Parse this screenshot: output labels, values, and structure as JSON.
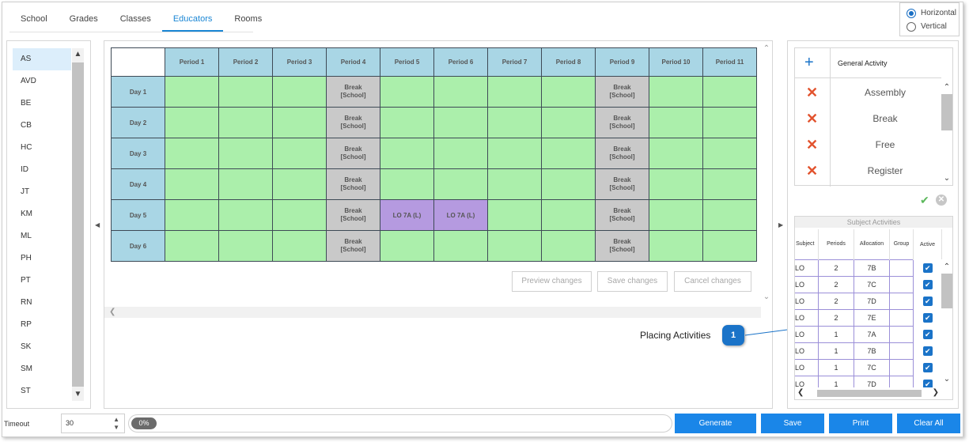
{
  "tabs": [
    "School",
    "Grades",
    "Classes",
    "Educators",
    "Rooms"
  ],
  "active_tab": "Educators",
  "orientation": {
    "options": [
      "Horizontal",
      "Vertical"
    ],
    "selected": "Horizontal"
  },
  "educators": [
    "AS",
    "AVD",
    "BE",
    "CB",
    "HC",
    "ID",
    "JT",
    "KM",
    "ML",
    "PH",
    "PT",
    "RN",
    "RP",
    "SK",
    "SM",
    "ST"
  ],
  "selected_educator": "AS",
  "timetable": {
    "periods": [
      "Period 1",
      "Period 2",
      "Period 3",
      "Period 4",
      "Period 5",
      "Period 6",
      "Period 7",
      "Period 8",
      "Period 9",
      "Period 10",
      "Period 11"
    ],
    "days": [
      "Day 1",
      "Day 2",
      "Day 3",
      "Day 4",
      "Day 5",
      "Day 6"
    ],
    "break_label": "Break",
    "break_scope": "[School]",
    "break_periods": [
      "Period 4",
      "Period 9"
    ],
    "activities": [
      {
        "day": "Day 5",
        "period": "Period 5",
        "label": "LO 7A (L)"
      },
      {
        "day": "Day 5",
        "period": "Period 6",
        "label": "LO 7A (L)"
      }
    ]
  },
  "change_buttons": {
    "preview": "Preview changes",
    "save": "Save changes",
    "cancel": "Cancel changes"
  },
  "callout": {
    "label": "Placing Activities",
    "number": "1"
  },
  "general_activity": {
    "title": "General Activity",
    "items": [
      "Assembly",
      "Break",
      "Free",
      "Register"
    ]
  },
  "subject_activities": {
    "title": "Subject Activities",
    "columns": [
      "Subject",
      "Periods",
      "Allocation",
      "Group",
      "Active"
    ],
    "rows": [
      {
        "subject": "LO",
        "periods": "2",
        "allocation": "7B",
        "group": ""
      },
      {
        "subject": "LO",
        "periods": "2",
        "allocation": "7C",
        "group": ""
      },
      {
        "subject": "LO",
        "periods": "2",
        "allocation": "7D",
        "group": ""
      },
      {
        "subject": "LO",
        "periods": "2",
        "allocation": "7E",
        "group": ""
      },
      {
        "subject": "LO",
        "periods": "1",
        "allocation": "7A",
        "group": ""
      },
      {
        "subject": "LO",
        "periods": "1",
        "allocation": "7B",
        "group": ""
      },
      {
        "subject": "LO",
        "periods": "1",
        "allocation": "7C",
        "group": ""
      },
      {
        "subject": "LO",
        "periods": "1",
        "allocation": "7D",
        "group": ""
      }
    ]
  },
  "bottom": {
    "timeout_label": "Timeout",
    "timeout_value": "30",
    "progress_text": "0%",
    "buttons": {
      "generate": "Generate",
      "save": "Save",
      "print": "Print",
      "clear": "Clear All"
    }
  },
  "colors": {
    "accent": "#1a86e8",
    "header_cell": "#a9d6e5",
    "empty_cell": "#abefab",
    "break_cell": "#c9c9c9",
    "activity_cell": "#b59ae0"
  }
}
